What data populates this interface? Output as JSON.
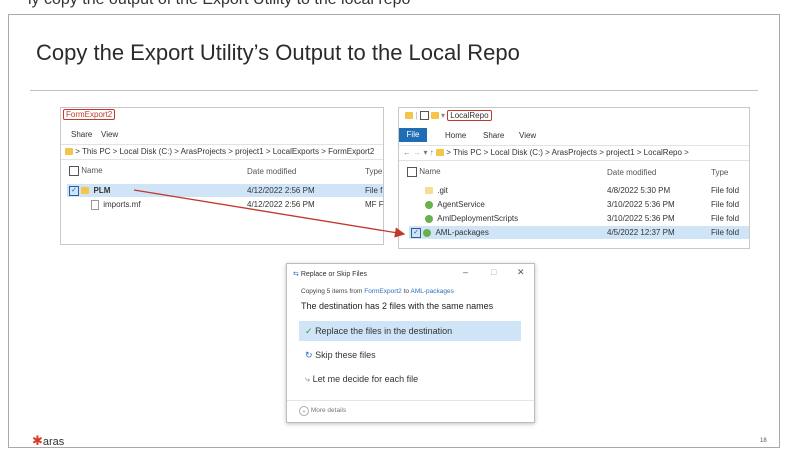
{
  "top_caption": "ly copy the output of the Export Utility to the local repo",
  "title": "Copy the Export Utility’s Output to the Local Repo",
  "left_window": {
    "folder_name": "FormExport2",
    "ribbon": [
      "Share",
      "View"
    ],
    "breadcrumb": "> This PC  >  Local Disk (C:)  >  ArasProjects  >  project1  >  LocalExports  >  FormExport2",
    "headers": {
      "name": "Name",
      "date": "Date modified",
      "type": "Type"
    },
    "rows": [
      {
        "name": "PLM",
        "date": "4/12/2022 2:56 PM",
        "type": "File f",
        "selected": true,
        "icon": "folder-icon"
      },
      {
        "name": "imports.mf",
        "date": "4/12/2022 2:56 PM",
        "type": "MF F",
        "selected": false,
        "icon": "file-icon"
      }
    ]
  },
  "right_window": {
    "folder_name": "LocalRepo",
    "ribbon": [
      "File",
      "Home",
      "Share",
      "View"
    ],
    "breadcrumb": "> This PC  >  Local Disk (C:)  >  ArasProjects  >  project1  >  LocalRepo  >",
    "headers": {
      "name": "Name",
      "date": "Date modified",
      "type": "Type"
    },
    "rows": [
      {
        "name": ".git",
        "date": "4/8/2022 5:30 PM",
        "type": "File fold",
        "selected": false,
        "icon": "folder-icon"
      },
      {
        "name": "AgentService",
        "date": "3/10/2022 5:36 PM",
        "type": "File fold",
        "selected": false,
        "icon": "green-folder-icon"
      },
      {
        "name": "AmlDeploymentScripts",
        "date": "3/10/2022 5:36 PM",
        "type": "File fold",
        "selected": false,
        "icon": "green-folder-icon"
      },
      {
        "name": "AML-packages",
        "date": "4/5/2022 12:37 PM",
        "type": "File fold",
        "selected": true,
        "icon": "green-folder-icon"
      }
    ]
  },
  "dialog": {
    "title": "Replace or Skip Files",
    "controls": [
      "–",
      "□",
      "✕"
    ],
    "copy_prefix": "Copying 5 items from ",
    "copy_from": "FormExport2",
    "copy_mid": " to ",
    "copy_to": "AML-packages",
    "heading": "The destination has 2 files with the same names",
    "options": [
      "Replace the files in the destination",
      "Skip these files",
      "Let me decide for each file"
    ],
    "more_details": "More details"
  },
  "logo": "aras",
  "page_number": "18",
  "colors": {
    "accent": "#c0392b",
    "selection": "#cfe4f7",
    "link": "#2f6fbf"
  }
}
